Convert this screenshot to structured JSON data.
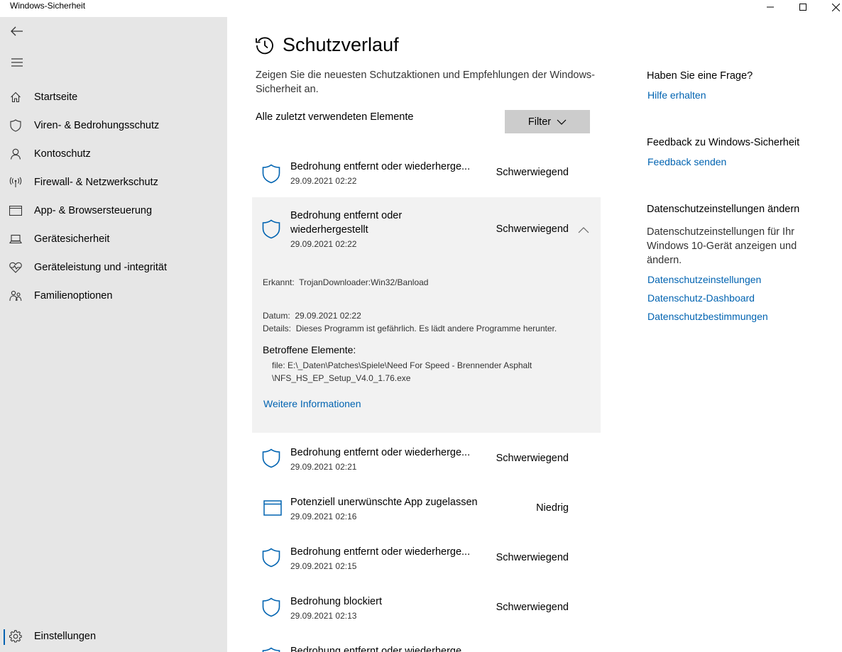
{
  "window": {
    "title": "Windows-Sicherheit",
    "controls": [
      "minimize-icon",
      "maximize-icon",
      "close-icon"
    ]
  },
  "sidebar": {
    "back_icon": "back-arrow-icon",
    "menu_icon": "hamburger-menu-icon",
    "items": [
      {
        "label": "Startseite",
        "icon": "home-icon"
      },
      {
        "label": "Viren- & Bedrohungsschutz",
        "icon": "shield-icon"
      },
      {
        "label": "Kontoschutz",
        "icon": "person-icon"
      },
      {
        "label": "Firewall- & Netzwerkschutz",
        "icon": "antenna-icon"
      },
      {
        "label": "App- & Browsersteuerung",
        "icon": "app-window-icon"
      },
      {
        "label": "Gerätesicherheit",
        "icon": "laptop-icon"
      },
      {
        "label": "Geräteleistung und -integrität",
        "icon": "heart-icon"
      },
      {
        "label": "Familienoptionen",
        "icon": "family-icon"
      }
    ],
    "settings": {
      "label": "Einstellungen",
      "icon": "gear-icon"
    }
  },
  "main": {
    "title": "Schutzverlauf",
    "title_icon": "history-icon",
    "description": "Zeigen Sie die neuesten Schutzaktionen und Empfehlungen der Windows-Sicherheit an.",
    "recent_label": "Alle zuletzt verwendeten Elemente",
    "filter_label": "Filter",
    "history": [
      {
        "title": "Bedrohung entfernt oder wiederherge...",
        "date": "29.09.2021 02:22",
        "severity": "Schwerwiegend",
        "icon": "shield-icon"
      },
      {
        "title_line1": "Bedrohung entfernt oder",
        "title_line2": "wiederhergestellt",
        "date": "29.09.2021 02:22",
        "severity": "Schwerwiegend",
        "icon": "shield-icon",
        "expanded": true,
        "detected_label": "Erkannt:",
        "detected_value": "TrojanDownloader:Win32/Banload",
        "date_label": "Datum:",
        "date_value": "29.09.2021 02:22",
        "details_label": "Details:",
        "details_value": "Dieses Programm ist gefährlich. Es lädt andere Programme herunter.",
        "affected_label": "Betroffene Elemente:",
        "affected_line1": "file: E:\\_Daten\\Patches\\Spiele\\Need For Speed - Brennender Asphalt",
        "affected_line2": "\\NFS_HS_EP_Setup_V4.0_1.76.exe",
        "more_link": "Weitere Informationen"
      },
      {
        "title": "Bedrohung entfernt oder wiederherge...",
        "date": "29.09.2021 02:21",
        "severity": "Schwerwiegend",
        "icon": "shield-icon"
      },
      {
        "title": "Potenziell unerwünschte App zugelassen",
        "date": "29.09.2021 02:16",
        "severity": "Niedrig",
        "icon": "app-window-icon"
      },
      {
        "title": "Bedrohung entfernt oder wiederherge...",
        "date": "29.09.2021 02:15",
        "severity": "Schwerwiegend",
        "icon": "shield-icon"
      },
      {
        "title": "Bedrohung blockiert",
        "date": "29.09.2021 02:13",
        "severity": "Schwerwiegend",
        "icon": "shield-icon"
      },
      {
        "title": "Bedrohung entfernt oder wiederherge...",
        "icon": "shield-icon"
      }
    ]
  },
  "right": {
    "question_heading": "Haben Sie eine Frage?",
    "help_link": "Hilfe erhalten",
    "feedback_heading": "Feedback zu Windows-Sicherheit",
    "feedback_link": "Feedback senden",
    "privacy_heading": "Datenschutzeinstellungen ändern",
    "privacy_text": "Datenschutzeinstellungen für Ihr Windows 10-Gerät anzeigen und ändern.",
    "privacy_links": [
      "Datenschutzeinstellungen",
      "Datenschutz-Dashboard",
      "Datenschutzbestimmungen"
    ]
  },
  "colors": {
    "accent": "#0063b1",
    "sidebar_bg": "#e6e6e6",
    "expanded_bg": "#f2f2f2",
    "filter_bg": "#cccccc"
  }
}
